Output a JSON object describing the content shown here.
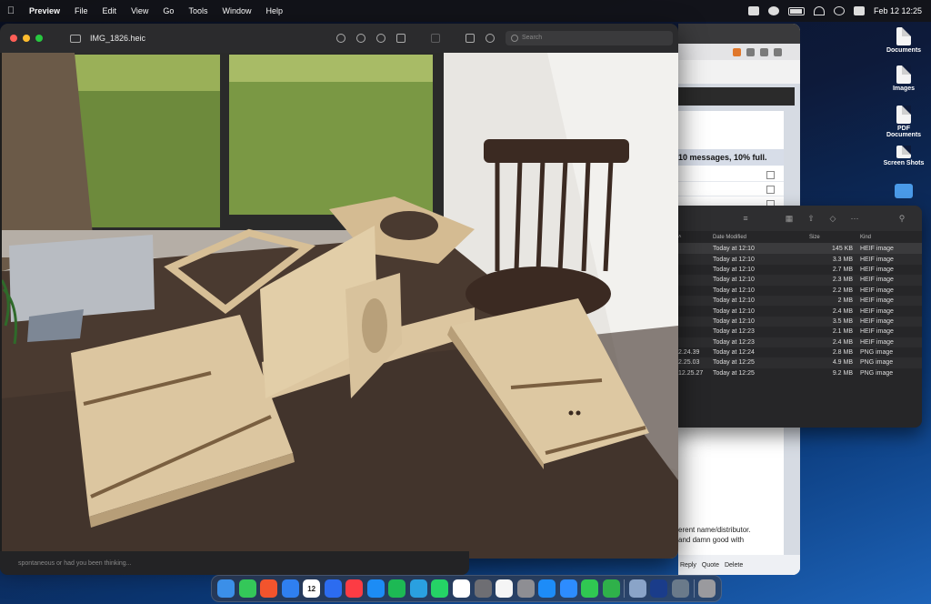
{
  "menubar": {
    "app": "Preview",
    "items": [
      "File",
      "Edit",
      "View",
      "Go",
      "Tools",
      "Window",
      "Help"
    ],
    "datetime": "Feb 12  12:25"
  },
  "desktop": {
    "icons": [
      "Documents",
      "Images",
      "PDF Documents",
      "Screen Shots"
    ]
  },
  "preview": {
    "title": "IMG_1826.heic",
    "search_placeholder": "Search"
  },
  "browser": {
    "mailbox_status": "10 messages, 10% full.",
    "body_line1": "erent name/distributor.",
    "body_line2": "and damn good with",
    "actions": [
      "Reply",
      "Quote",
      "Delete"
    ]
  },
  "finder": {
    "columns": [
      "Date Modified",
      "Size",
      "Kind"
    ],
    "files": [
      {
        "name": "",
        "date": "Today at 12:10",
        "size": "145 KB",
        "kind": "HEIF image"
      },
      {
        "name": "",
        "date": "Today at 12:10",
        "size": "3.3 MB",
        "kind": "HEIF image"
      },
      {
        "name": "",
        "date": "Today at 12:10",
        "size": "2.7 MB",
        "kind": "HEIF image"
      },
      {
        "name": "",
        "date": "Today at 12:10",
        "size": "2.3 MB",
        "kind": "HEIF image"
      },
      {
        "name": "",
        "date": "Today at 12:10",
        "size": "2.2 MB",
        "kind": "HEIF image"
      },
      {
        "name": "",
        "date": "Today at 12:10",
        "size": "2 MB",
        "kind": "HEIF image"
      },
      {
        "name": "",
        "date": "Today at 12:10",
        "size": "2.4 MB",
        "kind": "HEIF image"
      },
      {
        "name": "",
        "date": "Today at 12:10",
        "size": "3.5 MB",
        "kind": "HEIF image"
      },
      {
        "name": "",
        "date": "Today at 12:23",
        "size": "2.1 MB",
        "kind": "HEIF image"
      },
      {
        "name": "",
        "date": "Today at 12:23",
        "size": "2.4 MB",
        "kind": "HEIF image"
      },
      {
        "name": "2.24.39",
        "date": "Today at 12:24",
        "size": "2.8 MB",
        "kind": "PNG image"
      },
      {
        "name": "2.25.03",
        "date": "Today at 12:25",
        "size": "4.9 MB",
        "kind": "PNG image"
      },
      {
        "name": "12.25.27",
        "date": "Today at 12:25",
        "size": "9.2 MB",
        "kind": "PNG image"
      }
    ]
  },
  "messages": {
    "snippet": "spontaneous or had you been thinking..."
  },
  "dock": {
    "apps": [
      {
        "name": "finder",
        "color": "#3b8fe8"
      },
      {
        "name": "messages",
        "color": "#34c759"
      },
      {
        "name": "brave",
        "color": "#f2542d"
      },
      {
        "name": "mail",
        "color": "#2f7ff0"
      },
      {
        "name": "calendar",
        "color": "#ffffff",
        "label": "12"
      },
      {
        "name": "app-store-like",
        "color": "#2c6cf0"
      },
      {
        "name": "music",
        "color": "#fc3c44"
      },
      {
        "name": "app-store",
        "color": "#1c8cf5"
      },
      {
        "name": "spotify",
        "color": "#1db954"
      },
      {
        "name": "telegram",
        "color": "#2aa0e0"
      },
      {
        "name": "whatsapp",
        "color": "#25d366"
      },
      {
        "name": "r-app",
        "color": "#ffffff"
      },
      {
        "name": "calculator",
        "color": "#6e6e73"
      },
      {
        "name": "reminders",
        "color": "#f5f5f5"
      },
      {
        "name": "settings",
        "color": "#8e8e93"
      },
      {
        "name": "safari",
        "color": "#1d8cf8"
      },
      {
        "name": "zoom",
        "color": "#2d8cff"
      },
      {
        "name": "facetime",
        "color": "#30c852"
      },
      {
        "name": "numbers",
        "color": "#2fb14a"
      },
      {
        "name": "preview",
        "color": "#8aa4c8"
      },
      {
        "name": "xcode-like",
        "color": "#1a3c8a"
      },
      {
        "name": "magnifier",
        "color": "#6a7a8a"
      },
      {
        "name": "trash",
        "color": "#9a9a9e"
      }
    ]
  }
}
